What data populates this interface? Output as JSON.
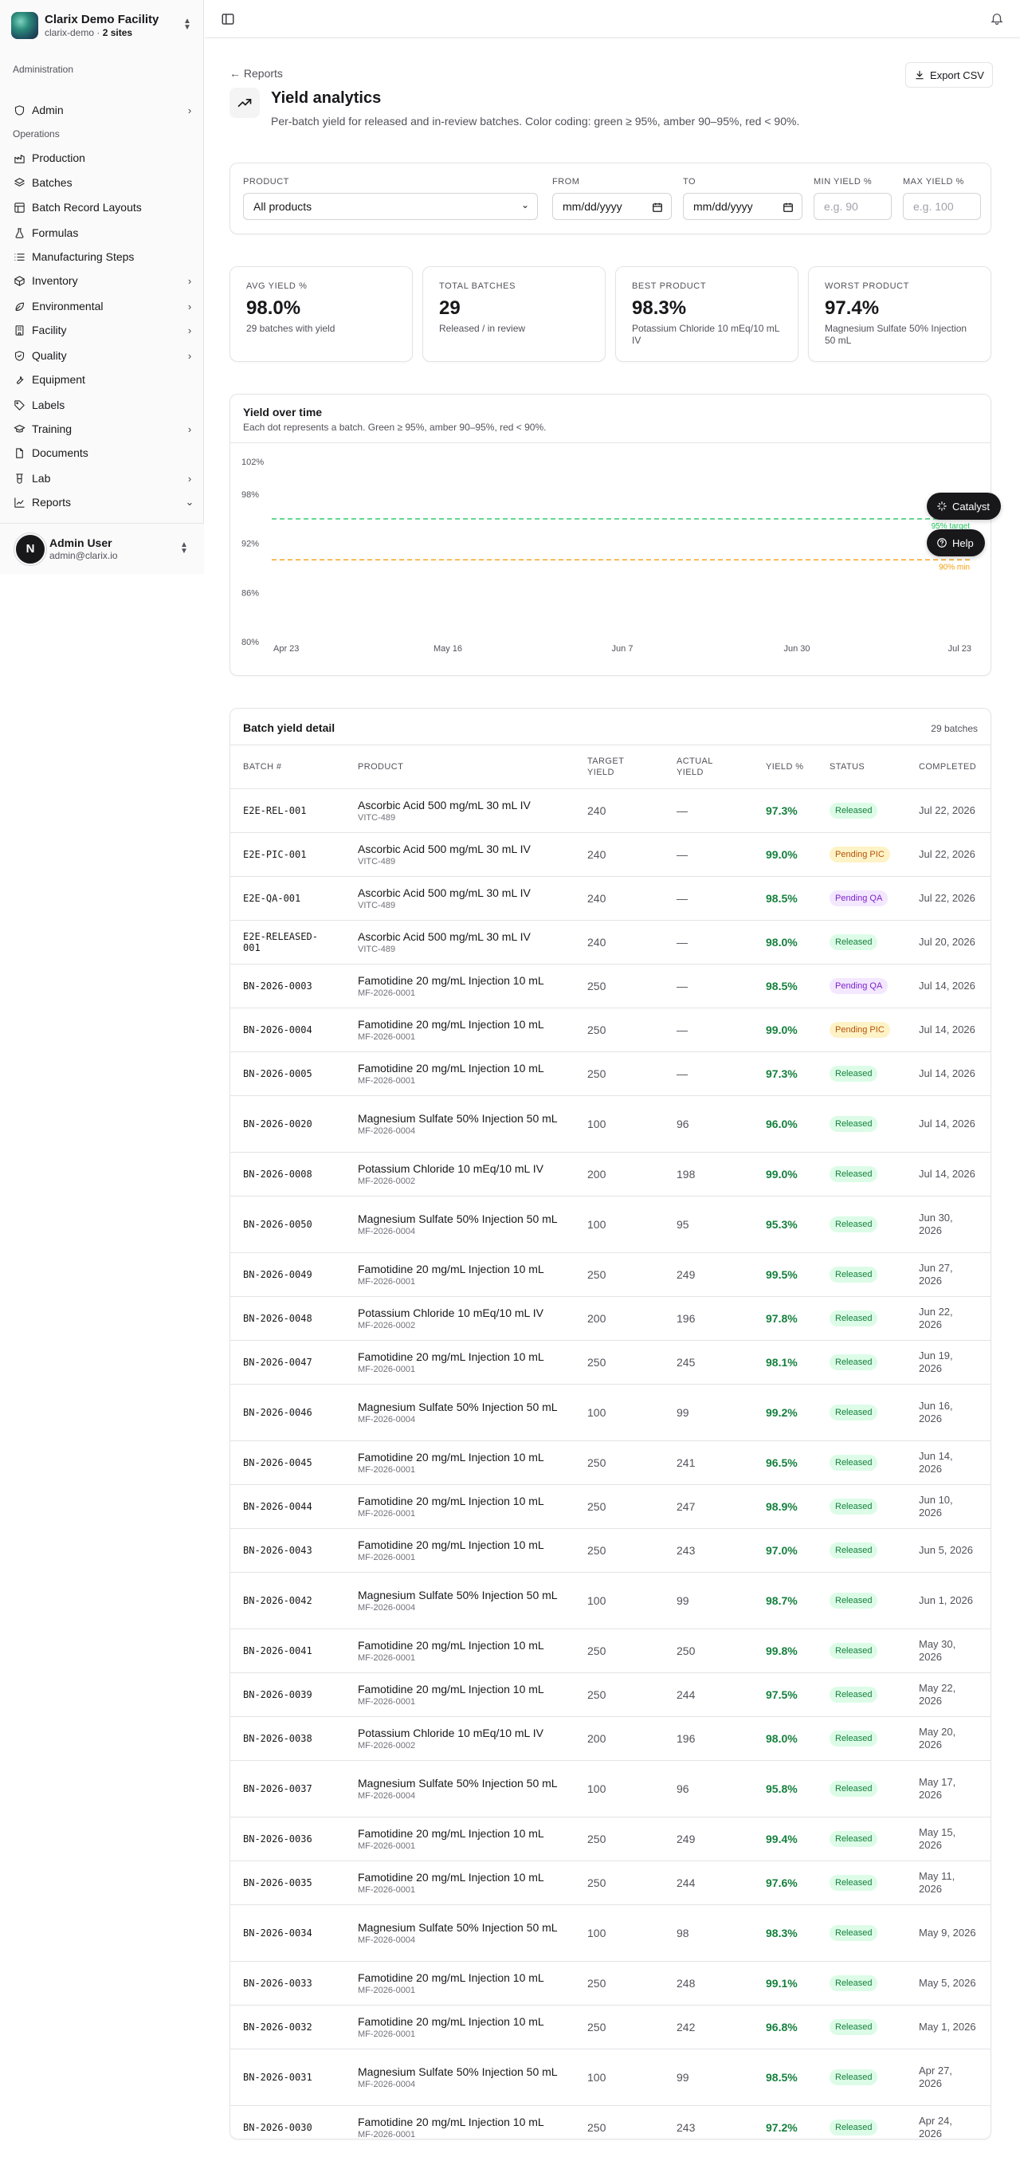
{
  "org": {
    "name": "Clarix Demo Facility",
    "slug": "clarix-demo · ",
    "sites": "2 sites"
  },
  "sidebar": {
    "group_admin": "Administration",
    "group_ops": "Operations",
    "items": [
      {
        "label": "Admin",
        "icon": "shield-icon",
        "chevron": "right"
      },
      {
        "label": "Production",
        "icon": "factory-icon",
        "chevron": ""
      },
      {
        "label": "Batches",
        "icon": "layers-icon",
        "chevron": ""
      },
      {
        "label": "Batch Record Layouts",
        "icon": "layout-icon",
        "chevron": ""
      },
      {
        "label": "Formulas",
        "icon": "flask-icon",
        "chevron": ""
      },
      {
        "label": "Manufacturing Steps",
        "icon": "list-icon",
        "chevron": ""
      },
      {
        "label": "Inventory",
        "icon": "box-icon",
        "chevron": "right"
      },
      {
        "label": "Environmental",
        "icon": "leaf-icon",
        "chevron": "right"
      },
      {
        "label": "Facility",
        "icon": "building-icon",
        "chevron": "right"
      },
      {
        "label": "Quality",
        "icon": "shield-check-icon",
        "chevron": "right"
      },
      {
        "label": "Equipment",
        "icon": "wrench-icon",
        "chevron": ""
      },
      {
        "label": "Labels",
        "icon": "tag-icon",
        "chevron": ""
      },
      {
        "label": "Training",
        "icon": "graduation-icon",
        "chevron": "right"
      },
      {
        "label": "Documents",
        "icon": "file-icon",
        "chevron": ""
      },
      {
        "label": "Lab",
        "icon": "beaker-icon",
        "chevron": "right"
      },
      {
        "label": "Reports",
        "icon": "chart-icon",
        "chevron": "down"
      }
    ]
  },
  "user": {
    "initial": "N",
    "name": "Admin User",
    "email": "admin@clarix.io"
  },
  "header": {
    "back": "← Reports",
    "export": "Export CSV",
    "title": "Yield analytics",
    "description": "Per-batch yield for released and in-review batches. Color coding: green ≥ 95%, amber 90–95%, red < 90%."
  },
  "filters": {
    "product_label": "Product",
    "product_value": "All products",
    "from_label": "From",
    "from_value": "mm/dd/yyyy",
    "to_label": "To",
    "to_value": "mm/dd/yyyy",
    "min_label": "Min yield %",
    "min_placeholder": "e.g. 90",
    "max_label": "Max yield %",
    "max_placeholder": "e.g. 100"
  },
  "kpis": [
    {
      "caption": "Avg yield %",
      "value": "98.0%",
      "sub": "29 batches with yield"
    },
    {
      "caption": "Total batches",
      "value": "29",
      "sub": "Released / in review"
    },
    {
      "caption": "Best product",
      "value": "98.3%",
      "sub": "Potassium Chloride 10 mEq/10 mL IV"
    },
    {
      "caption": "Worst product",
      "value": "97.4%",
      "sub": "Magnesium Sulfate 50% Injection 50 mL"
    }
  ],
  "chart_data": {
    "type": "scatter",
    "title": "Yield over time",
    "subtitle": "Each dot represents a batch. Green ≥ 95%, amber 90–95%, red < 90%.",
    "y_ticks": [
      "102%",
      "98%",
      "92%",
      "86%",
      "80%"
    ],
    "x_ticks": [
      "Apr 23",
      "May 16",
      "Jun 7",
      "Jun 30",
      "Jul 23"
    ],
    "ylim": [
      80,
      102
    ],
    "reference_lines": [
      {
        "label": "95% target",
        "value": 95,
        "color": "#22c55e"
      },
      {
        "label": "90% min",
        "value": 90,
        "color": "#f59e0b"
      }
    ],
    "points": []
  },
  "assistant": {
    "catalyst": "Catalyst",
    "help": "Help"
  },
  "table": {
    "title": "Batch yield detail",
    "count": "29 batches",
    "columns": [
      "Batch #",
      "Product",
      "Target yield",
      "Actual yield",
      "Yield %",
      "Status",
      "Completed"
    ],
    "rows": [
      {
        "batch": "E2E-REL-001",
        "product": "Ascorbic Acid 500 mg/mL 30 mL IV",
        "code": "VITC-489",
        "target": "240",
        "actual": "—",
        "yield": "97.3%",
        "status": "Released",
        "completed": "Jul 22, 2026"
      },
      {
        "batch": "E2E-PIC-001",
        "product": "Ascorbic Acid 500 mg/mL 30 mL IV",
        "code": "VITC-489",
        "target": "240",
        "actual": "—",
        "yield": "99.0%",
        "status": "Pending PIC",
        "completed": "Jul 22, 2026"
      },
      {
        "batch": "E2E-QA-001",
        "product": "Ascorbic Acid 500 mg/mL 30 mL IV",
        "code": "VITC-489",
        "target": "240",
        "actual": "—",
        "yield": "98.5%",
        "status": "Pending QA",
        "completed": "Jul 22, 2026"
      },
      {
        "batch": "E2E-RELEASED-001",
        "product": "Ascorbic Acid 500 mg/mL 30 mL IV",
        "code": "VITC-489",
        "target": "240",
        "actual": "—",
        "yield": "98.0%",
        "status": "Released",
        "completed": "Jul 20, 2026"
      },
      {
        "batch": "BN-2026-0003",
        "product": "Famotidine 20 mg/mL Injection 10 mL",
        "code": "MF-2026-0001",
        "target": "250",
        "actual": "—",
        "yield": "98.5%",
        "status": "Pending QA",
        "completed": "Jul 14, 2026"
      },
      {
        "batch": "BN-2026-0004",
        "product": "Famotidine 20 mg/mL Injection 10 mL",
        "code": "MF-2026-0001",
        "target": "250",
        "actual": "—",
        "yield": "99.0%",
        "status": "Pending PIC",
        "completed": "Jul 14, 2026"
      },
      {
        "batch": "BN-2026-0005",
        "product": "Famotidine 20 mg/mL Injection 10 mL",
        "code": "MF-2026-0001",
        "target": "250",
        "actual": "—",
        "yield": "97.3%",
        "status": "Released",
        "completed": "Jul 14, 2026"
      },
      {
        "batch": "BN-2026-0020",
        "product": "Magnesium Sulfate 50% Injection 50 mL",
        "code": "MF-2026-0004",
        "target": "100",
        "actual": "96",
        "yield": "96.0%",
        "status": "Released",
        "completed": "Jul 14, 2026"
      },
      {
        "batch": "BN-2026-0008",
        "product": "Potassium Chloride 10 mEq/10 mL IV",
        "code": "MF-2026-0002",
        "target": "200",
        "actual": "198",
        "yield": "99.0%",
        "status": "Released",
        "completed": "Jul 14, 2026"
      },
      {
        "batch": "BN-2026-0050",
        "product": "Magnesium Sulfate 50% Injection 50 mL",
        "code": "MF-2026-0004",
        "target": "100",
        "actual": "95",
        "yield": "95.3%",
        "status": "Released",
        "completed": "Jun 30, 2026"
      },
      {
        "batch": "BN-2026-0049",
        "product": "Famotidine 20 mg/mL Injection 10 mL",
        "code": "MF-2026-0001",
        "target": "250",
        "actual": "249",
        "yield": "99.5%",
        "status": "Released",
        "completed": "Jun 27, 2026"
      },
      {
        "batch": "BN-2026-0048",
        "product": "Potassium Chloride 10 mEq/10 mL IV",
        "code": "MF-2026-0002",
        "target": "200",
        "actual": "196",
        "yield": "97.8%",
        "status": "Released",
        "completed": "Jun 22, 2026"
      },
      {
        "batch": "BN-2026-0047",
        "product": "Famotidine 20 mg/mL Injection 10 mL",
        "code": "MF-2026-0001",
        "target": "250",
        "actual": "245",
        "yield": "98.1%",
        "status": "Released",
        "completed": "Jun 19, 2026"
      },
      {
        "batch": "BN-2026-0046",
        "product": "Magnesium Sulfate 50% Injection 50 mL",
        "code": "MF-2026-0004",
        "target": "100",
        "actual": "99",
        "yield": "99.2%",
        "status": "Released",
        "completed": "Jun 16, 2026"
      },
      {
        "batch": "BN-2026-0045",
        "product": "Famotidine 20 mg/mL Injection 10 mL",
        "code": "MF-2026-0001",
        "target": "250",
        "actual": "241",
        "yield": "96.5%",
        "status": "Released",
        "completed": "Jun 14, 2026"
      },
      {
        "batch": "BN-2026-0044",
        "product": "Famotidine 20 mg/mL Injection 10 mL",
        "code": "MF-2026-0001",
        "target": "250",
        "actual": "247",
        "yield": "98.9%",
        "status": "Released",
        "completed": "Jun 10, 2026"
      },
      {
        "batch": "BN-2026-0043",
        "product": "Famotidine 20 mg/mL Injection 10 mL",
        "code": "MF-2026-0001",
        "target": "250",
        "actual": "243",
        "yield": "97.0%",
        "status": "Released",
        "completed": "Jun 5, 2026"
      },
      {
        "batch": "BN-2026-0042",
        "product": "Magnesium Sulfate 50% Injection 50 mL",
        "code": "MF-2026-0004",
        "target": "100",
        "actual": "99",
        "yield": "98.7%",
        "status": "Released",
        "completed": "Jun 1, 2026"
      },
      {
        "batch": "BN-2026-0041",
        "product": "Famotidine 20 mg/mL Injection 10 mL",
        "code": "MF-2026-0001",
        "target": "250",
        "actual": "250",
        "yield": "99.8%",
        "status": "Released",
        "completed": "May 30, 2026"
      },
      {
        "batch": "BN-2026-0039",
        "product": "Famotidine 20 mg/mL Injection 10 mL",
        "code": "MF-2026-0001",
        "target": "250",
        "actual": "244",
        "yield": "97.5%",
        "status": "Released",
        "completed": "May 22, 2026"
      },
      {
        "batch": "BN-2026-0038",
        "product": "Potassium Chloride 10 mEq/10 mL IV",
        "code": "MF-2026-0002",
        "target": "200",
        "actual": "196",
        "yield": "98.0%",
        "status": "Released",
        "completed": "May 20, 2026"
      },
      {
        "batch": "BN-2026-0037",
        "product": "Magnesium Sulfate 50% Injection 50 mL",
        "code": "MF-2026-0004",
        "target": "100",
        "actual": "96",
        "yield": "95.8%",
        "status": "Released",
        "completed": "May 17, 2026"
      },
      {
        "batch": "BN-2026-0036",
        "product": "Famotidine 20 mg/mL Injection 10 mL",
        "code": "MF-2026-0001",
        "target": "250",
        "actual": "249",
        "yield": "99.4%",
        "status": "Released",
        "completed": "May 15, 2026"
      },
      {
        "batch": "BN-2026-0035",
        "product": "Famotidine 20 mg/mL Injection 10 mL",
        "code": "MF-2026-0001",
        "target": "250",
        "actual": "244",
        "yield": "97.6%",
        "status": "Released",
        "completed": "May 11, 2026"
      },
      {
        "batch": "BN-2026-0034",
        "product": "Magnesium Sulfate 50% Injection 50 mL",
        "code": "MF-2026-0004",
        "target": "100",
        "actual": "98",
        "yield": "98.3%",
        "status": "Released",
        "completed": "May 9, 2026"
      },
      {
        "batch": "BN-2026-0033",
        "product": "Famotidine 20 mg/mL Injection 10 mL",
        "code": "MF-2026-0001",
        "target": "250",
        "actual": "248",
        "yield": "99.1%",
        "status": "Released",
        "completed": "May 5, 2026"
      },
      {
        "batch": "BN-2026-0032",
        "product": "Famotidine 20 mg/mL Injection 10 mL",
        "code": "MF-2026-0001",
        "target": "250",
        "actual": "242",
        "yield": "96.8%",
        "status": "Released",
        "completed": "May 1, 2026"
      },
      {
        "batch": "BN-2026-0031",
        "product": "Magnesium Sulfate 50% Injection 50 mL",
        "code": "MF-2026-0004",
        "target": "100",
        "actual": "99",
        "yield": "98.5%",
        "status": "Released",
        "completed": "Apr 27, 2026"
      },
      {
        "batch": "BN-2026-0030",
        "product": "Famotidine 20 mg/mL Injection 10 mL",
        "code": "MF-2026-0001",
        "target": "250",
        "actual": "243",
        "yield": "97.2%",
        "status": "Released",
        "completed": "Apr 24, 2026"
      }
    ]
  }
}
